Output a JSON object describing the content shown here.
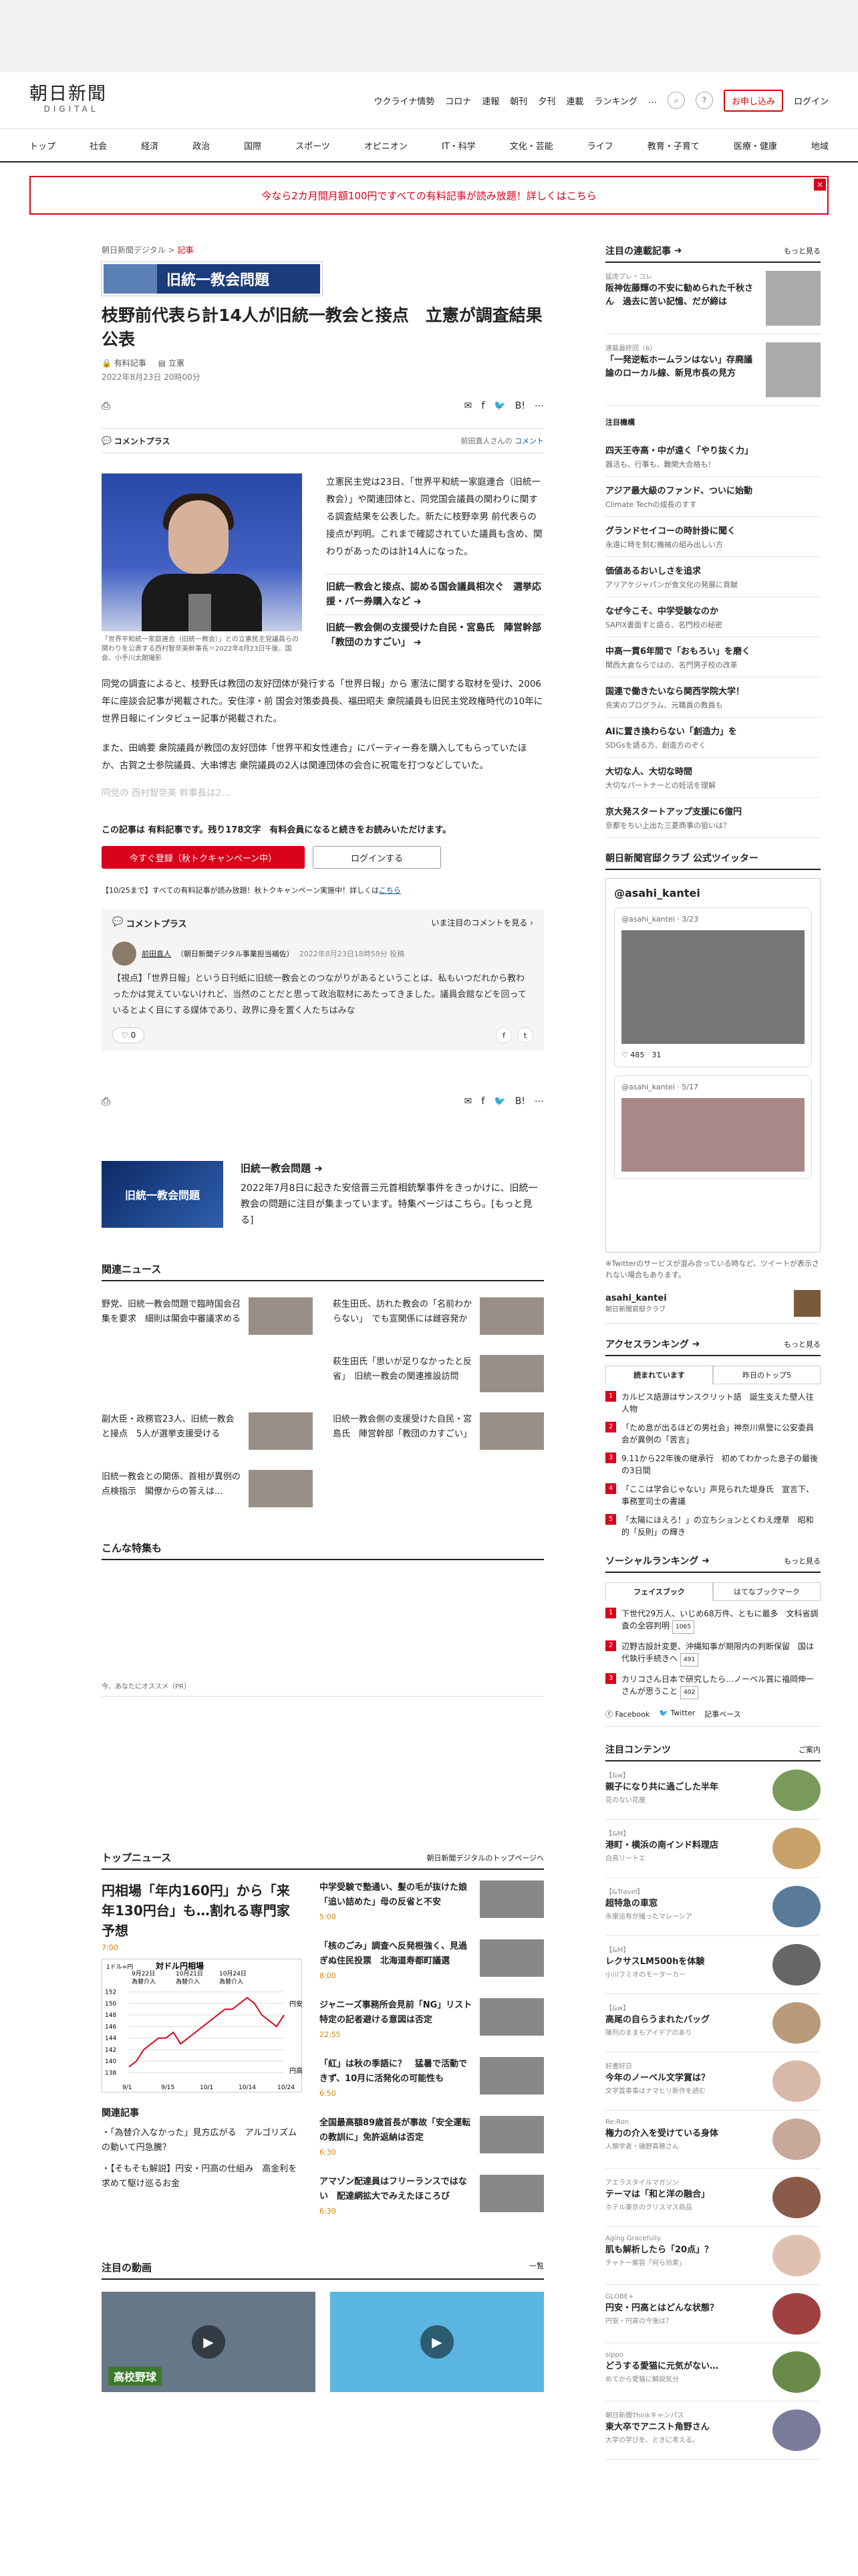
{
  "header": {
    "logo_jp": "朝日新聞",
    "logo_en": "DIGITAL",
    "nav": [
      "ウクライナ情勢",
      "コロナ",
      "速報",
      "朝刊",
      "夕刊",
      "連載",
      "ランキング",
      "…"
    ],
    "subscribe": "お申し込み",
    "login": "ログイン"
  },
  "gnav": [
    "トップ",
    "社会",
    "経済",
    "政治",
    "国際",
    "スポーツ",
    "オピニオン",
    "IT・科学",
    "文化・芸能",
    "ライフ",
    "教育・子育て",
    "医療・健康",
    "地域"
  ],
  "banner": "今なら2カ月間月額100円ですべての有料記事が読み放題！詳しくはこちら",
  "article": {
    "crumb_site": "朝日新聞デジタル",
    "crumb_sep": ">",
    "crumb_cat": "記事",
    "topic_banner": "旧統一教会問題",
    "title": "枝野前代表ら計14人が旧統一教会と接点　立憲が調査結果公表",
    "meta_paid": "有料記事",
    "meta_party": "立憲",
    "date": "2022年8月23日 20時00分",
    "comment_plus": "コメントプラス",
    "comment_by": "前田直人さんの",
    "comment_link": "コメント",
    "caption": "「世界平和統一家庭連合（旧統一教会）」との立憲民主党議員らの関わりを公表する西村智奈美幹事長＝2022年8月23日午後、国会、小手川太朗撮影",
    "lead": "立憲民主党は23日、「世界平和統一家庭連合（旧統一教会）」や関連団体と、同党国会議員の関わりに関する調査結果を公表した。新たに枝野幸男 前代表らの接点が判明。これまで確認されていた議員も含め、関わりがあったのは計14人になった。",
    "related1": "旧統一教会と接点、認める国会議員相次ぐ　選挙応援・パー券購入など",
    "related2": "旧統一教会側の支援受けた自民・宮島氏　陣営幹部「教団のカすごい」",
    "p1": "同党の調査によると、枝野氏は教団の友好団体が発行する「世界日報」から 憲法に関する取材を受け、2006年に座談会記事が掲載された。安住淳・前 国会対策委員長、福田昭夫 衆院議員も旧民主党政権時代の10年に世界日報にインタビュー記事が掲載された。",
    "p2": "また、田嶋要 衆院議員が教団の友好団体「世界平和女性連合」にパーティー券を購入してもらっていたほか、古賀之士参院議員、大串博志 衆院議員の2人は関連団体の会合に祝電を打つなどしていた。",
    "p3": "同党の 西村智奈美 幹事長は2…",
    "paywall": "この記事は 有料記事です。残り178文字　有料会員になると続きをお読みいただけます。",
    "btn_register": "今すぐ登録（秋トクキャンペーン中）",
    "btn_login": "ログインする",
    "notice": "【10/25まで】すべての有料記事が読み放題！秋トクキャンペーン実施中！詳しくは",
    "notice_link": "こちら"
  },
  "comment_box": {
    "title": "コメントプラス",
    "right": "いま注目のコメントを見る",
    "author": "前田直人",
    "role": "（朝日新聞デジタル事業担当補佐）",
    "time": "2022年8月23日18時58分 投稿",
    "text": "【視点】「世界日報」という日刊紙に旧統一教会とのつながりがあるということは、私もいつだれから教わったかは覚えていないけれど、当然のことだと思って政治取材にあたってきました。議員会館などを回っているとよく目にする媒体であり、政界に身を置く人たちはみな",
    "likes": "0"
  },
  "topic_card": {
    "image_label": "旧統一教会問題",
    "title": "旧統一教会問題",
    "desc": "2022年7月8日に起きた安倍晋三元首相銃撃事件をきっかけに、旧統一教会の問題に注目が集まっています。特集ページはこちら。[もっと見る]"
  },
  "related_news": {
    "heading": "関連ニュース",
    "items": [
      "野党、旧統一教会問題で臨時国会召集を要求　細則は閣会中審議求める",
      "萩生田氏、訪れた教会の「名前わからない」　でも宣関係には雌容発か",
      "",
      "萩生田氏「思いが足りなかったと反省」　旧統一教会の関連推設訪問",
      "副大臣・政務官23人、旧統一教会と接点　5人が選挙支援受ける",
      "旧統一教会側の支援受けた自民・宮島氏　陣営幹部「教団のカすごい」",
      "旧統一教会との関係、首相が異例の点検指示　閣僚からの答えは…",
      ""
    ]
  },
  "sections": {
    "konna": "こんな特集も",
    "osusume": "今、あなたにオススメ（PR）"
  },
  "top_news": {
    "heading": "トップニュース",
    "link": "朝日新聞デジタルのトップページへ",
    "main_title": "円相場「年内160円」から「来年130円台」も…割れる専門家予想",
    "main_time": "7:00",
    "related_head": "関連記事",
    "related": [
      "「為替介入なかった」見方広がる　アルゴリズムの動いて円急騰？",
      "【そもそも解説】円安・円高の仕組み　高金利を求めて駆け巡るお金"
    ],
    "items": [
      {
        "t": "中学受験で塾通い、髪の毛が抜けた娘　「追い詰めた」母の反省と不安",
        "tm": "5:00"
      },
      {
        "t": "「核のごみ」調査へ反発根強く、見過ぎぬ住民投票　北海道寿都町議選",
        "tm": "8:00"
      },
      {
        "t": "ジャニーズ事務所会見前「NG」リスト　特定の記者避ける意図は否定",
        "tm": "22:55"
      },
      {
        "t": "「紅」は秋の季語に？　猛暑で活動できず、10月に活発化の可能性も",
        "tm": "6:50"
      },
      {
        "t": "全国最高額89歳首長が事故「安全運転の教訓に」免許返納は否定",
        "tm": "6:30"
      },
      {
        "t": "アマゾン配達員はフリーランスではない　配達網拡大でみえたほころび",
        "tm": "6:30"
      }
    ]
  },
  "chart_data": {
    "type": "line",
    "title": "対ドル円相場",
    "annotations": [
      "9月22日",
      "10月21日",
      "10月24日",
      "為替介入",
      "為替介入",
      "為替介入"
    ],
    "ylabel_top": "円安",
    "ylabel_bottom": "円高",
    "unit": "1ドル=円",
    "y_ticks": [
      152,
      150,
      148,
      146,
      144,
      142,
      140,
      138
    ],
    "x_ticks": [
      "9/1",
      "9/15",
      "10/1",
      "10/14",
      "10/24"
    ],
    "values": [
      139,
      140,
      142,
      143,
      144,
      144,
      145,
      143,
      144,
      145,
      146,
      147,
      148,
      149,
      149,
      150,
      151,
      150,
      148,
      147,
      146,
      148
    ]
  },
  "videos": {
    "heading": "注目の動画",
    "link": "一覧",
    "v1_label": "高校野球",
    "v2_label": ""
  },
  "sidebar": {
    "renzoku": "注目の連載記事",
    "more": "もっと見る",
    "renzoku_items": [
      {
        "cat": "猛虎プレ・コレ",
        "t": "阪神佐藤輝の不安に勧められた千秋さん　過去に苦い記憶、だが締は"
      },
      {
        "cat": "連載最終回（6）",
        "t": "「一発逆転ホームランはない」存廃議論のローカル線、新見市長の見方"
      }
    ],
    "chumoku": "注目機構",
    "chumoku_items": [
      {
        "t": "四天王寺高・中が遠く「やり抜く力」",
        "s": "器活も、行事も、難関大合格も！"
      },
      {
        "t": "アジア最大級のファンド、ついに始動",
        "s": "Climate Techの成長のすす"
      },
      {
        "t": "グランドセイコーの時計掛に聞く",
        "s": "永遠に時を刻む機械の組み出しい方"
      },
      {
        "t": "価値あるおいしさを追求",
        "s": "アリアケジャパンが食文化の発展に貢献"
      },
      {
        "t": "なぜ今こそ、中学受験なのか",
        "s": "SAPIX書面すと語る、名門校の秘密"
      },
      {
        "t": "中高一貫6年間で「おもろい」を磨く",
        "s": "関西大倉ならではの、名門男子校の改革"
      },
      {
        "t": "国連で働きたいなら関西学院大学！",
        "s": "充実のプログラム、元職員の教員も"
      },
      {
        "t": "AIに置き換わらない「創造力」を",
        "s": "SDGsを語る方、創造方のぞく"
      },
      {
        "t": "大切な人、大切な時間",
        "s": "大切なパートナーとの妊活を理解"
      },
      {
        "t": "京大発スタートアップ支援に6億円",
        "s": "京都をちい上出た三菱商事の狙いは？"
      }
    ],
    "twitter_head": "朝日新聞官邸クラブ 公式ツイッター",
    "tw_handle": "@asahi_kantei",
    "tw1_meta": "@asahi_kantei · 3/23",
    "tw1_stats": "485　31",
    "tw2_meta": "@asahi_kantei · 5/17",
    "tw_note": "※Twitterのサービスが混み合っている時など、ツイートが表示されない場合もあります。",
    "tw_acct": "asahi_kantei",
    "tw_acct_sub": "朝日新聞官邸クラブ",
    "ranking": "アクセスランキング",
    "rk_tab1": "読まれています",
    "rk_tab2": "昨日のトップ5",
    "rk_items": [
      "カルピス語源はサンスクリット語　誕生支えた壁人往人物",
      "「ため息が出るほどの男社会」神奈川県警に公安委員会が異例の「苦言」",
      "9.11から22年後の継承行　初めてわかった息子の最後の3日間",
      "「ここは学会じゃない」声見られた堤身氏　宣言下、事務室司士の書議",
      "「太陽にほえろ！」の立ちションとくわえ煙草　昭和的「反則」の輝き"
    ],
    "social": "ソーシャルランキング",
    "so_tab1": "フェイスブック",
    "so_tab2": "はてなブックマーク",
    "so_items": [
      {
        "t": "下世代29万人、いじめ68万件、ともに最多　文科省調査の全容判明",
        "c": "1065"
      },
      {
        "t": "辺野古設計変更、沖縄知事が期限内の判断保留　国は代執行手続きへ",
        "c": "491"
      },
      {
        "t": "カリコさん日本で研究したら…ノーベル賞に福岡伸一さんが思うこと",
        "c": "402"
      }
    ],
    "fb": "Facebook",
    "tw": "Twitter",
    "kiji": "記事ベース",
    "contents": "注目コンテンツ",
    "contents_more": "ご案内",
    "contents_items": [
      {
        "cat": "【&w】",
        "t": "親子になり共に過ごした半年",
        "s": "花のない花屋"
      },
      {
        "cat": "【&M】",
        "t": "港町・横浜の南インド料理店",
        "s": "白鳥リートエ"
      },
      {
        "cat": "【&Travel】",
        "t": "超特急の車窓",
        "s": "永康运有が撮ったマレーシア"
      },
      {
        "cat": "【&M】",
        "t": "レクサスLM500hを体験",
        "s": "小川フミオのモーターカー"
      },
      {
        "cat": "【&w】",
        "t": "高尾の自らうまれたバッグ",
        "s": "陳列のままもアイデアのあり"
      },
      {
        "cat": "好書好日",
        "t": "今年のノーベル文学賞は？",
        "s": "文学賞事事はナマヒリ新作を読む"
      },
      {
        "cat": "Re:Ron",
        "t": "権力の介入を受けている身体",
        "s": "人類学者・磯野真穂さん"
      },
      {
        "cat": "アエラスタイルマガジン",
        "t": "テーマは「和と洋の融合」",
        "s": "ホテル東京のクリスマス商品"
      },
      {
        "cat": "Aging Gracefully",
        "t": "肌も解析したら「20点」？",
        "s": "チャトー案容「何ら効果」"
      },
      {
        "cat": "GLOBE+",
        "t": "円安・円高とはどんな状態？",
        "s": "円安・円高の今後は？"
      },
      {
        "cat": "sippo",
        "t": "どうする愛猫に元気がない…",
        "s": "めてから愛猫に解説気分"
      },
      {
        "cat": "朝日新聞Thinkキャンパス",
        "t": "東大卒でアニスト角野さん",
        "s": "大学の学びを、ときに考える。"
      }
    ]
  }
}
